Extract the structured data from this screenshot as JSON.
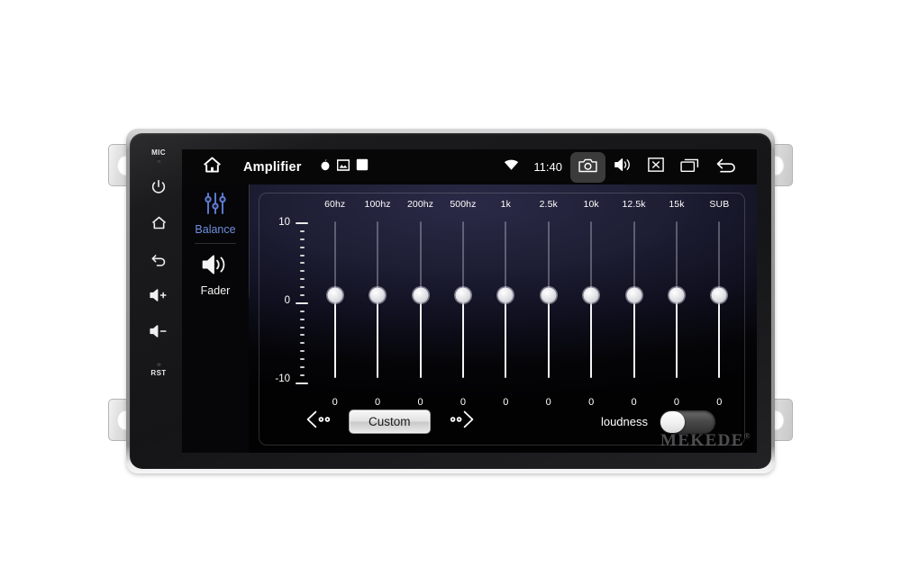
{
  "device": {
    "brand_watermark": "MEKEDE",
    "watermark_mark": "®",
    "hardkeys": [
      {
        "name": "mic",
        "label": "MIC",
        "type": "hole-label"
      },
      {
        "name": "power",
        "label": "",
        "type": "icon"
      },
      {
        "name": "home",
        "label": "",
        "type": "icon"
      },
      {
        "name": "back",
        "label": "",
        "type": "icon"
      },
      {
        "name": "volume-up",
        "label": "",
        "type": "icon"
      },
      {
        "name": "volume-down",
        "label": "",
        "type": "icon"
      },
      {
        "name": "reset",
        "label": "RST",
        "type": "hole-label"
      }
    ]
  },
  "statusbar": {
    "home_icon": "home-icon",
    "title": "Amplifier",
    "title_icons": [
      "circle-icon",
      "picture-icon",
      "square-icon"
    ],
    "wifi_icon": "wifi-icon",
    "clock": "11:40",
    "camera_icon": "camera-icon",
    "volume_icon": "volume-icon",
    "close_icon": "close-box-icon",
    "recents_icon": "recent-apps-icon",
    "back_icon": "back-arrow-icon"
  },
  "sidebar": {
    "items": [
      {
        "label": "Balance",
        "icon": "equalizer-sliders-icon",
        "active": true
      },
      {
        "label": "Fader",
        "icon": "speaker-icon",
        "active": false
      }
    ],
    "active_color": "#6f8fe0"
  },
  "equalizer": {
    "scale": {
      "max_label": "10",
      "mid_label": "0",
      "min_label": "-10"
    },
    "bands": [
      {
        "freq": "60hz",
        "value": "0"
      },
      {
        "freq": "100hz",
        "value": "0"
      },
      {
        "freq": "200hz",
        "value": "0"
      },
      {
        "freq": "500hz",
        "value": "0"
      },
      {
        "freq": "1k",
        "value": "0"
      },
      {
        "freq": "2.5k",
        "value": "0"
      },
      {
        "freq": "10k",
        "value": "0"
      },
      {
        "freq": "12.5k",
        "value": "0"
      },
      {
        "freq": "15k",
        "value": "0"
      },
      {
        "freq": "SUB",
        "value": "0"
      }
    ]
  },
  "controls": {
    "prev_icon": "chevron-left-icon",
    "next_icon": "chevron-right-icon",
    "preset_label": "Custom",
    "loudness_label": "loudness",
    "loudness_on": false
  }
}
